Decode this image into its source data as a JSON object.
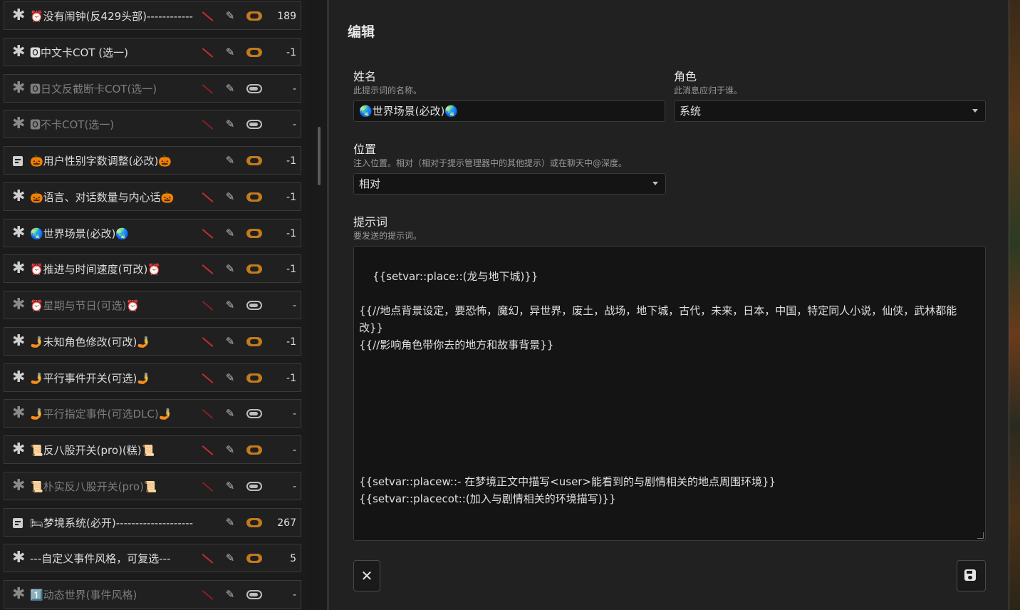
{
  "prompt_list": {
    "items": [
      {
        "icon": "asterisk",
        "name": "⏰没有闹钟(反429头部)------------",
        "disabled_flag": true,
        "enabled": true,
        "tokens": "189",
        "dim": false
      },
      {
        "icon": "asterisk",
        "name": "🅾中文卡COT (选一)",
        "disabled_flag": true,
        "enabled": true,
        "tokens": "-1",
        "dim": false
      },
      {
        "icon": "asterisk",
        "name": "🅾日文反截断卡COT(选一)",
        "disabled_flag": true,
        "enabled": false,
        "tokens": "-",
        "dim": true
      },
      {
        "icon": "asterisk",
        "name": "🅾不卡COT(选一)",
        "disabled_flag": true,
        "enabled": false,
        "tokens": "-",
        "dim": true
      },
      {
        "icon": "document",
        "name": "🎃用户性别字数调整(必改)🎃",
        "disabled_flag": false,
        "enabled": true,
        "tokens": "-1",
        "dim": false
      },
      {
        "icon": "asterisk",
        "name": "🎃语言、对话数量与内心话🎃",
        "disabled_flag": true,
        "enabled": true,
        "tokens": "-1",
        "dim": false
      },
      {
        "icon": "asterisk",
        "name": "🌏世界场景(必改)🌏",
        "disabled_flag": true,
        "enabled": true,
        "tokens": "-1",
        "dim": false
      },
      {
        "icon": "asterisk",
        "name": "⏰推进与时间速度(可改)⏰",
        "disabled_flag": true,
        "enabled": true,
        "tokens": "-1",
        "dim": false
      },
      {
        "icon": "asterisk",
        "name": "⏰星期与节日(可选)⏰",
        "disabled_flag": true,
        "enabled": false,
        "tokens": "-",
        "dim": true
      },
      {
        "icon": "asterisk",
        "name": "🤳未知角色修改(可改)🤳",
        "disabled_flag": true,
        "enabled": true,
        "tokens": "-1",
        "dim": false
      },
      {
        "icon": "asterisk",
        "name": "🤳平行事件开关(可选)🤳",
        "disabled_flag": true,
        "enabled": true,
        "tokens": "-1",
        "dim": false
      },
      {
        "icon": "asterisk",
        "name": "🤳平行指定事件(可选DLC)🤳",
        "disabled_flag": true,
        "enabled": false,
        "tokens": "-",
        "dim": true
      },
      {
        "icon": "asterisk",
        "name": "📜反八股开关(pro)(糕)📜",
        "disabled_flag": true,
        "enabled": true,
        "tokens": "-",
        "dim": false
      },
      {
        "icon": "asterisk",
        "name": "📜朴实反八股开关(pro)📜",
        "disabled_flag": true,
        "enabled": false,
        "tokens": "-",
        "dim": true
      },
      {
        "icon": "document",
        "name": "🛏梦境系统(必开)--------------------",
        "disabled_flag": false,
        "enabled": true,
        "tokens": "267",
        "dim": false
      },
      {
        "icon": "asterisk",
        "name": "---自定义事件风格，可复选---",
        "disabled_flag": true,
        "enabled": true,
        "tokens": "5",
        "dim": false
      },
      {
        "icon": "asterisk",
        "name": "1️⃣动态世界(事件风格)",
        "disabled_flag": true,
        "enabled": false,
        "tokens": "-",
        "dim": true
      }
    ]
  },
  "editor": {
    "title": "编辑",
    "name_label": "姓名",
    "name_hint": "此提示词的名称。",
    "name_value": "🌏世界场景(必改)🌏",
    "role_label": "角色",
    "role_hint": "此消息应归于谁。",
    "role_value": "系统",
    "position_label": "位置",
    "position_hint": "注入位置。相对（相对于提示管理器中的其他提示）或在聊天中@深度。",
    "position_value": "相对",
    "prompt_label": "提示词",
    "prompt_hint": "要发送的提示词。",
    "prompt_value": "{{setvar::place::(龙与地下城)}}\n\n{{//地点背景设定，要恐怖，魔幻，异世界，废土，战场，地下城，古代，未来，日本，中国，特定同人小说，仙侠，武林都能改}}\n{{//影响角色带你去的地方和故事背景}}\n\n\n\n\n\n\n\n{{setvar::placew::- 在梦境正文中描写<user>能看到的与剧情相关的地点周围环境}}\n{{setvar::placecot::(加入与剧情相关的环境描写)}}",
    "close_glyph": "✕"
  },
  "glyphs": {
    "asterisk": "✱",
    "pencil": "✎",
    "eye_off": "👁"
  }
}
